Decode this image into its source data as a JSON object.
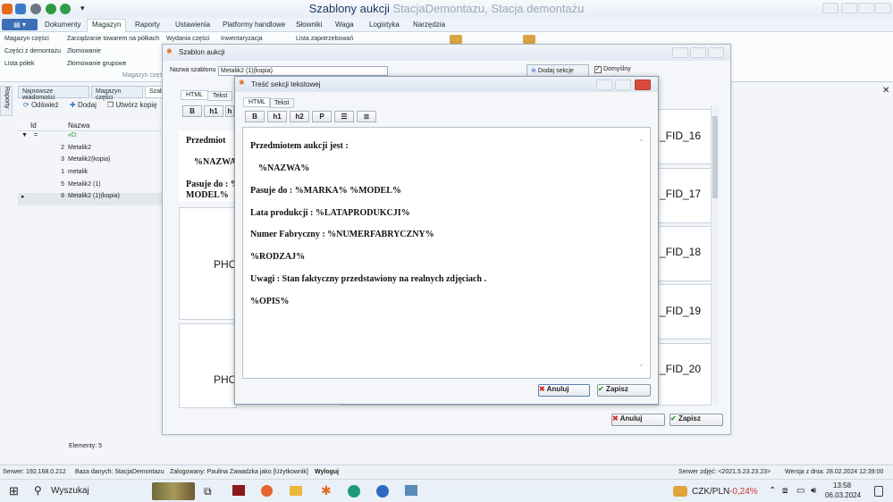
{
  "app": {
    "title": "Szablony aukcji",
    "subtitle": "StacjaDemontazu, Stacja demontażu"
  },
  "ribbon": {
    "tabs": [
      "Dokumenty",
      "Magazyn",
      "Raporty",
      "Ustawienia",
      "Platformy handlowe",
      "Słowniki",
      "Waga",
      "Logistyka",
      "Narzędzia"
    ],
    "col1": [
      "Magazyn części",
      "Części z demontażu",
      "Lista półek"
    ],
    "col2": [
      "Zarządzanie towarem na półkach",
      "Złomowanie",
      "Złomowanie grupowe"
    ],
    "col3": [
      "Wydania części"
    ],
    "col4": [
      "Inwentaryzacja"
    ],
    "col5": [
      "Lista zapotrzebowań"
    ],
    "group_label": "Magazyn częś"
  },
  "side_tab": "Raporty",
  "doc_tabs": [
    "Najnowsze wiadomości",
    "Magazyn części",
    "Szab"
  ],
  "toolbar": {
    "refresh": "Odśwież",
    "add": "Dodaj",
    "copy": "Utwórz kopię"
  },
  "grid": {
    "col_id": "Id",
    "col_name": "Nazwa",
    "filter_op": "=",
    "filter_value": "«D:",
    "rows": [
      {
        "id": "2",
        "name": "Metalik2"
      },
      {
        "id": "3",
        "name": "Metalik2(kopia)"
      },
      {
        "id": "1",
        "name": "metalik"
      },
      {
        "id": "5",
        "name": "Metalik2 (1)"
      },
      {
        "id": "8",
        "name": "Metalik2 (1)(kopia)"
      }
    ],
    "footer": "Elementy: 5"
  },
  "template_dialog": {
    "title": "Szablon aukcji",
    "name_label": "Nazwa szablonu",
    "name_value": "Metalik2 (1)(kopia)",
    "add_section": "Dodaj sekcje",
    "default_label": "Domyślny",
    "tabs": [
      "HTML",
      "Tekst"
    ],
    "preview_lines": [
      "Przedmiot",
      "%NAZWA",
      "Pasuje do : %",
      "MODEL%"
    ],
    "photo_label": "PHO",
    "fid_labels": [
      "_FID_16",
      "_FID_17",
      "_FID_18",
      "_FID_19",
      "_FID_20"
    ],
    "cancel": "Anuluj",
    "save": "Zapisz"
  },
  "text_dialog": {
    "title": "Treść sekcji tekstowej",
    "tabs": [
      "HTML",
      "Tekst"
    ],
    "buttons": [
      "B",
      "h1",
      "h2",
      "P"
    ],
    "content": [
      "Przedmiotem aukcji jest :",
      "%NAZWA%",
      "Pasuje do : %MARKA% %MODEL%",
      "Lata produkcji : %LATAPRODUKCJI%",
      "Numer Fabryczny : %NUMERFABRYCZNY%",
      "%RODZAJ%",
      "Uwagi : Stan faktyczny przedstawiony na realnych zdjęciach .",
      "%OPIS%"
    ],
    "cancel": "Anuluj",
    "save": "Zapisz"
  },
  "statusbar": {
    "server": "Serwer: 192.168.0.212",
    "database": "Baza danych: StacjaDemontazu",
    "logged": "Zalogowany: Paulina Zawadzka jako [Użytkownik]",
    "logout": "Wyloguj",
    "photo_server": "Serwer zdjęć: <2021.5.23.23.23>",
    "version": "Wersja z dnia: 28.02.2024 12:39:00"
  },
  "taskbar": {
    "search": "Wyszukaj",
    "currency": "CZK/PLN",
    "change": "-0,24%",
    "time": "13:58",
    "date": "06.03.2024"
  },
  "colors": {
    "accent": "#3b6fb6",
    "negative": "#d23030"
  }
}
